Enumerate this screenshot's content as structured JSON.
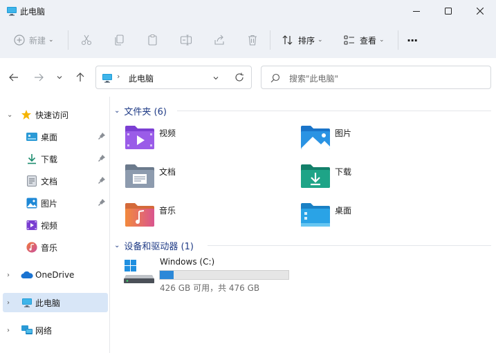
{
  "window": {
    "title": "此电脑"
  },
  "toolbar": {
    "new_label": "新建",
    "sort_label": "排序",
    "view_label": "查看",
    "more_label": "···"
  },
  "address": {
    "path": "此电脑"
  },
  "search": {
    "placeholder": "搜索\"此电脑\""
  },
  "sidebar": {
    "quick_access": "快速访问",
    "items": [
      {
        "label": "桌面",
        "icon": "desktop-icon",
        "pinned": true
      },
      {
        "label": "下载",
        "icon": "download-icon",
        "pinned": true
      },
      {
        "label": "文档",
        "icon": "document-icon",
        "pinned": true
      },
      {
        "label": "图片",
        "icon": "pictures-icon",
        "pinned": true
      },
      {
        "label": "视频",
        "icon": "videos-icon",
        "pinned": false
      },
      {
        "label": "音乐",
        "icon": "music-icon",
        "pinned": false
      }
    ],
    "onedrive": "OneDrive",
    "this_pc": "此电脑",
    "network": "网络"
  },
  "content": {
    "folders_header": "文件夹 (6)",
    "folders": [
      {
        "label": "视频",
        "icon": "videos-folder-icon"
      },
      {
        "label": "图片",
        "icon": "pictures-folder-icon"
      },
      {
        "label": "文档",
        "icon": "documents-folder-icon"
      },
      {
        "label": "下载",
        "icon": "downloads-folder-icon"
      },
      {
        "label": "音乐",
        "icon": "music-folder-icon"
      },
      {
        "label": "桌面",
        "icon": "desktop-folder-icon"
      }
    ],
    "drives_header": "设备和驱动器 (1)",
    "drive": {
      "name": "Windows (C:)",
      "info": "426 GB 可用，共 476 GB",
      "used_fraction": 0.105
    }
  },
  "colors": {
    "accent": "#2b88d8",
    "header_text": "#1f3b86",
    "selected_bg": "#d8e6f7"
  }
}
